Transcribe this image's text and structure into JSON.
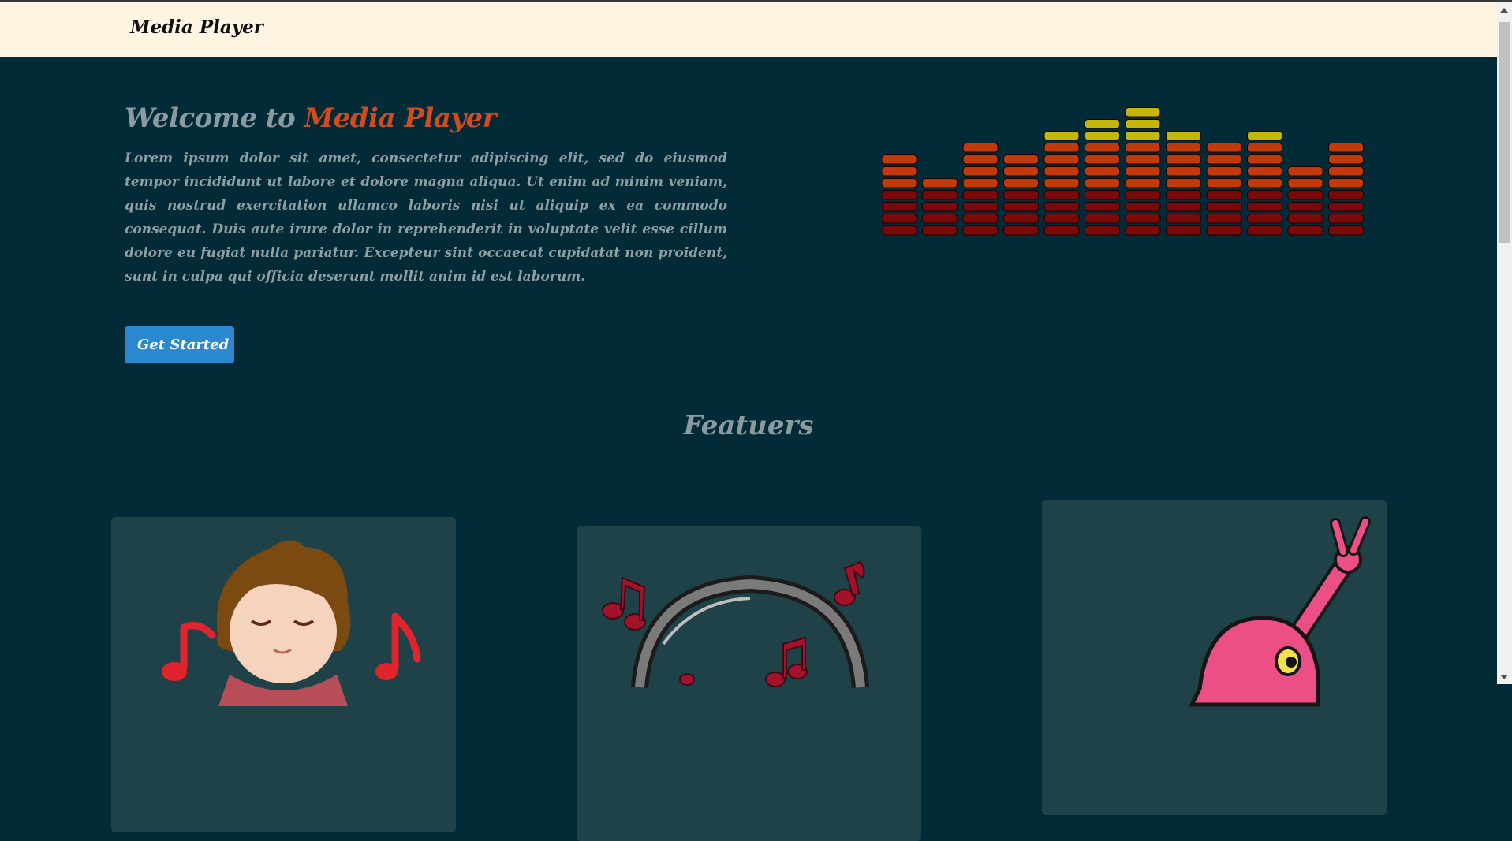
{
  "navbar": {
    "brand": "Media Player"
  },
  "hero": {
    "title_prefix": "Welcome to",
    "title_accent": "Media Player",
    "paragraph": "Lorem ipsum dolor sit amet, consectetur adipiscing elit, sed do eiusmod tempor incididunt ut labore et dolore magna aliqua. Ut enim ad minim veniam, quis nostrud exercitation ullamco laboris nisi ut aliquip ex ea commodo consequat. Duis aute irure dolor in reprehenderit in voluptate velit esse cillum dolore eu fugiat nulla pariatur. Excepteur sint occaecat cupidatat non proident, sunt in culpa qui officia deserunt mollit anim id est laborum.",
    "cta_label": "Get Started"
  },
  "equalizer": {
    "levels": [
      7,
      5,
      8,
      7,
      9,
      10,
      11,
      9,
      8,
      9,
      6,
      8
    ],
    "max_level": 11,
    "colors": {
      "low": "#7a0a0a",
      "mid": "#c23a0c",
      "high": "#c4b70a"
    }
  },
  "features": {
    "title": "Featuers",
    "cards": [
      {
        "image": "boy-listening-music-illustration"
      },
      {
        "image": "headphones-music-notes-illustration"
      },
      {
        "image": "pink-character-peace-sign-illustration"
      }
    ]
  },
  "colors": {
    "background": "#032a37",
    "navbar": "#fdf5e2",
    "accent": "#d24a1e",
    "button": "#2a88d0",
    "card": "#1f4249"
  }
}
